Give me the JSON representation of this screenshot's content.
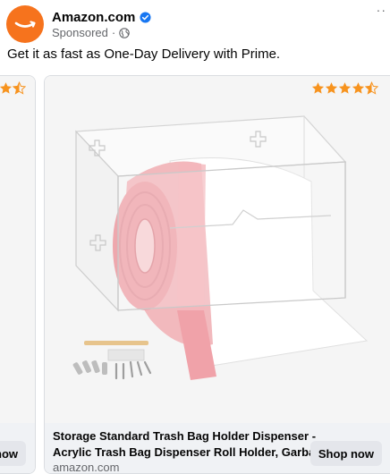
{
  "post": {
    "page_name": "Amazon.com",
    "sponsored_label": "Sponsored",
    "separator": "·",
    "more_glyph": "··",
    "caption": "Get it as fast as One-Day Delivery with Prime.",
    "avatar_icon": "amazon-smile-logo",
    "brand_color": "#f6731d",
    "verified_color": "#1877f2"
  },
  "carousel": {
    "previous_card": {
      "rating": 4.5,
      "cta_label": "now"
    },
    "main_card": {
      "rating": 4.5,
      "title_line1": "Storage Standard Trash Bag Holder Dispenser -",
      "title_line2": "Acrylic Trash Bag Dispenser Roll Holder, Garba...",
      "domain": "amazon.com",
      "cta_label": "Shop now",
      "star_color": "#f7931e"
    }
  }
}
